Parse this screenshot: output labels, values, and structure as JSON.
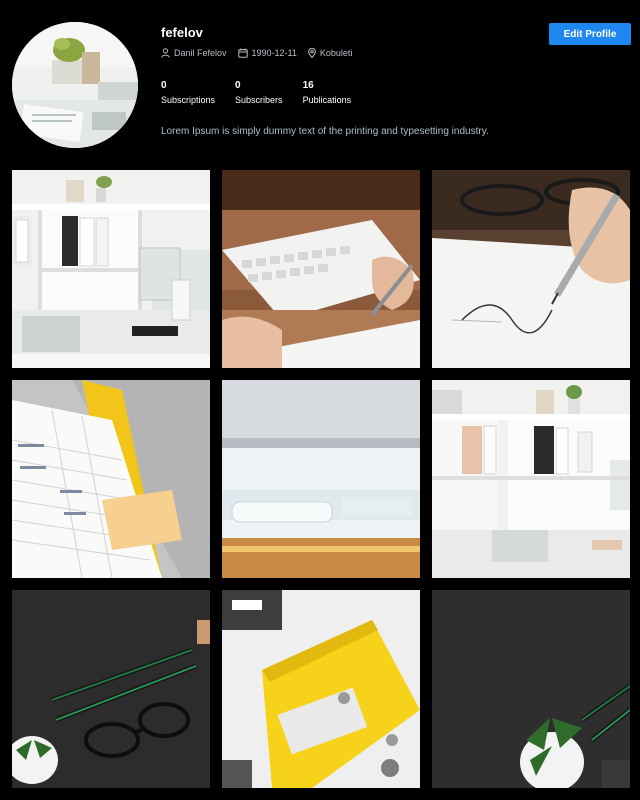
{
  "profile": {
    "username": "fefelov",
    "full_name": "Danil Fefelov",
    "birth_date": "1990-12-11",
    "location": "Kobuleti",
    "bio": "Lorem Ipsum is simply dummy text of the printing and typesetting industry.",
    "edit_button_label": "Edit Profile",
    "avatar_icon": "avatar-icon"
  },
  "stats": [
    {
      "value": "0",
      "label": "Subscriptions"
    },
    {
      "value": "0",
      "label": "Subscribers"
    },
    {
      "value": "16",
      "label": "Publications"
    }
  ],
  "icons": {
    "user": "user-icon",
    "calendar": "calendar-icon",
    "location": "location-pin-icon"
  },
  "colors": {
    "background": "#000000",
    "accent": "#1e88f0",
    "text_primary": "#ffffff",
    "text_muted": "#b9bec6",
    "bio_text": "#a9c1c9"
  },
  "gallery": {
    "items": [
      {
        "subject": "office-shelves"
      },
      {
        "subject": "hands-writing-keyboard"
      },
      {
        "subject": "hand-signing-document"
      },
      {
        "subject": "yellow-folder-table"
      },
      {
        "subject": "desk-documents-closeup"
      },
      {
        "subject": "office-shelves-2"
      },
      {
        "subject": "pens-glasses-dark"
      },
      {
        "subject": "yellow-binder"
      },
      {
        "subject": "dark-desk-plant"
      }
    ]
  }
}
